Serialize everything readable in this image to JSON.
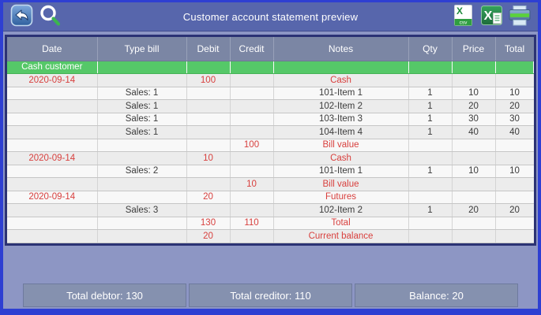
{
  "toolbar": {
    "title": "Customer account statement preview",
    "icons": {
      "back": "back-arrow",
      "search": "magnifier",
      "csv_letter": "X",
      "csv_badge": "csv",
      "excel_letter": "X",
      "print": "printer"
    }
  },
  "colors": {
    "frame_blue": "#2e3fd2",
    "toolbar_blue": "#5766ac",
    "page_lavender": "#8d96c4",
    "table_border_navy": "#2b3274",
    "header_gray_blue": "#7b86a4",
    "customer_green": "#55c868",
    "summary_red": "#d8403e",
    "footer_cell": "#8591af"
  },
  "table": {
    "columns": [
      "Date",
      "Type bill",
      "Debit",
      "Credit",
      "Notes",
      "Qty",
      "Price",
      "Total"
    ],
    "rows": [
      {
        "variant": "customer",
        "date": "Cash customer",
        "type_bill": "",
        "debit": "",
        "credit": "",
        "notes": "",
        "qty": "",
        "price": "",
        "total": ""
      },
      {
        "variant": "summary",
        "date": "2020-09-14",
        "type_bill": "",
        "debit": "100",
        "credit": "",
        "notes": "Cash",
        "qty": "",
        "price": "",
        "total": ""
      },
      {
        "variant": "item",
        "date": "",
        "type_bill": "Sales: 1",
        "debit": "",
        "credit": "",
        "notes": "101-Item 1",
        "qty": "1",
        "price": "10",
        "total": "10"
      },
      {
        "variant": "item",
        "date": "",
        "type_bill": "Sales: 1",
        "debit": "",
        "credit": "",
        "notes": "102-Item 2",
        "qty": "1",
        "price": "20",
        "total": "20"
      },
      {
        "variant": "item",
        "date": "",
        "type_bill": "Sales: 1",
        "debit": "",
        "credit": "",
        "notes": "103-Item 3",
        "qty": "1",
        "price": "30",
        "total": "30"
      },
      {
        "variant": "item",
        "date": "",
        "type_bill": "Sales: 1",
        "debit": "",
        "credit": "",
        "notes": "104-Item 4",
        "qty": "1",
        "price": "40",
        "total": "40"
      },
      {
        "variant": "summary",
        "date": "",
        "type_bill": "",
        "debit": "",
        "credit": "100",
        "notes": "Bill value",
        "qty": "",
        "price": "",
        "total": ""
      },
      {
        "variant": "summary",
        "date": "2020-09-14",
        "type_bill": "",
        "debit": "10",
        "credit": "",
        "notes": "Cash",
        "qty": "",
        "price": "",
        "total": ""
      },
      {
        "variant": "item",
        "date": "",
        "type_bill": "Sales: 2",
        "debit": "",
        "credit": "",
        "notes": "101-Item 1",
        "qty": "1",
        "price": "10",
        "total": "10"
      },
      {
        "variant": "summary",
        "date": "",
        "type_bill": "",
        "debit": "",
        "credit": "10",
        "notes": "Bill value",
        "qty": "",
        "price": "",
        "total": ""
      },
      {
        "variant": "summary",
        "date": "2020-09-14",
        "type_bill": "",
        "debit": "20",
        "credit": "",
        "notes": "Futures",
        "qty": "",
        "price": "",
        "total": ""
      },
      {
        "variant": "item",
        "date": "",
        "type_bill": "Sales: 3",
        "debit": "",
        "credit": "",
        "notes": "102-Item 2",
        "qty": "1",
        "price": "20",
        "total": "20"
      },
      {
        "variant": "summary",
        "date": "",
        "type_bill": "",
        "debit": "130",
        "credit": "110",
        "notes": "Total",
        "qty": "",
        "price": "",
        "total": ""
      },
      {
        "variant": "summary",
        "date": "",
        "type_bill": "",
        "debit": "20",
        "credit": "",
        "notes": "Current balance",
        "qty": "",
        "price": "",
        "total": ""
      }
    ]
  },
  "footer": {
    "total_debtor": "Total debtor: 130",
    "total_creditor": "Total creditor: 110",
    "balance": "Balance: 20"
  }
}
